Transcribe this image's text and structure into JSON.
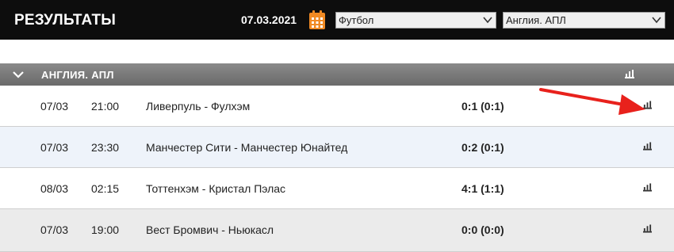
{
  "header": {
    "title": "РЕЗУЛЬТАТЫ",
    "date": "07.03.2021",
    "sport_select": "Футбол",
    "league_select": "Англия. АПЛ"
  },
  "league": {
    "name": "АНГЛИЯ. АПЛ"
  },
  "matches": [
    {
      "date": "07/03",
      "time": "21:00",
      "teams": "Ливерпуль - Фулхэм",
      "score": "0:1 (0:1)"
    },
    {
      "date": "07/03",
      "time": "23:30",
      "teams": "Манчестер Сити - Манчестер Юнайтед",
      "score": "0:2 (0:1)"
    },
    {
      "date": "08/03",
      "time": "02:15",
      "teams": "Тоттенхэм - Кристал Пэлас",
      "score": "4:1 (1:1)"
    },
    {
      "date": "07/03",
      "time": "19:00",
      "teams": "Вест Бромвич - Ньюкасл",
      "score": "0:0 (0:0)"
    }
  ],
  "colors": {
    "topbar": "#0d0d0d",
    "calendar": "#f08a24",
    "annotation_arrow": "#e8211c"
  },
  "icons": [
    "calendar-icon",
    "chevron-down-icon",
    "stats-icon",
    "red-arrow"
  ]
}
